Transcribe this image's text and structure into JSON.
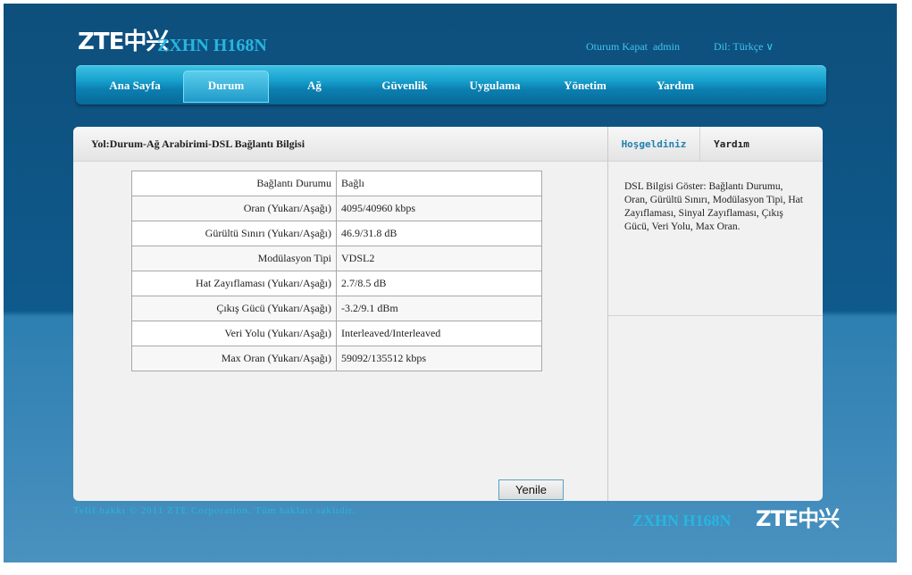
{
  "header": {
    "logo": "ZTE中兴",
    "model": "ZXHN H168N",
    "logout_label": "Oturum Kapat",
    "username": "admin",
    "language_label": "Dil: Türkçe ∨"
  },
  "nav": {
    "items": [
      {
        "label": "Ana Sayfa"
      },
      {
        "label": "Durum"
      },
      {
        "label": "Ağ"
      },
      {
        "label": "Güvenlik"
      },
      {
        "label": "Uygulama"
      },
      {
        "label": "Yönetim"
      },
      {
        "label": "Yardım"
      }
    ],
    "active": "Durum"
  },
  "main": {
    "path": "Yol:Durum-Ağ Arabirimi-DSL Bağlantı Bilgisi",
    "rows": [
      {
        "label": "Bağlantı Durumu",
        "value": "Bağlı"
      },
      {
        "label": "Oran (Yukarı/Aşağı)",
        "value": "4095/40960 kbps"
      },
      {
        "label": "Gürültü Sınırı (Yukarı/Aşağı)",
        "value": "46.9/31.8 dB"
      },
      {
        "label": "Modülasyon Tipi",
        "value": "VDSL2"
      },
      {
        "label": "Hat Zayıflaması (Yukarı/Aşağı)",
        "value": "2.7/8.5 dB"
      },
      {
        "label": "Çıkış Gücü (Yukarı/Aşağı)",
        "value": "-3.2/9.1 dBm"
      },
      {
        "label": "Veri Yolu (Yukarı/Aşağı)",
        "value": "Interleaved/Interleaved"
      },
      {
        "label": "Max Oran (Yukarı/Aşağı)",
        "value": "59092/135512 kbps"
      }
    ],
    "refresh_label": "Yenile"
  },
  "sidebar": {
    "tab_welcome": "Hoşgeldiniz",
    "tab_help": "Yardım",
    "help_text": "DSL Bilgisi Göster: Bağlantı Durumu, Oran, Gürültü Sınırı, Modülasyon Tipi, Hat Zayıflaması, Sinyal Zayıflaması, Çıkış Gücü, Veri Yolu, Max Oran."
  },
  "footer": {
    "copyright": "Telif hakkı © 2011 ZTE Corporation. Tüm hakları saklıdır.",
    "model": "ZXHN H168N",
    "logo": "ZTE中兴"
  },
  "colors": {
    "accent": "#27b6e0",
    "nav_active": "#1e98c8",
    "background": "#0f5a8c"
  }
}
